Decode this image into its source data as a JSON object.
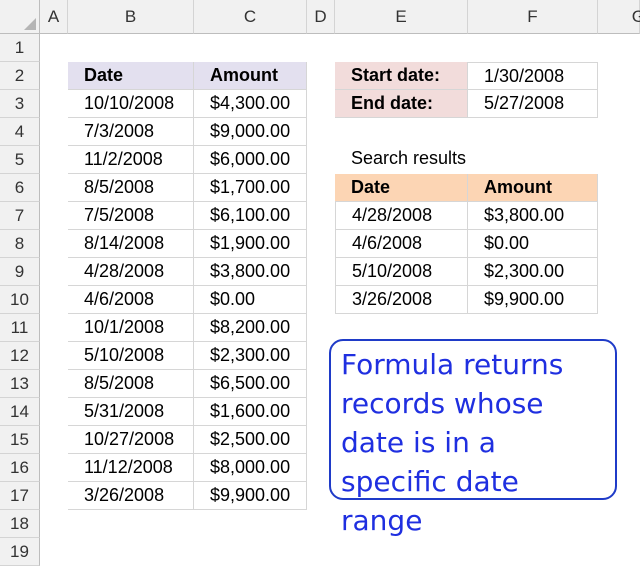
{
  "columns": [
    "A",
    "B",
    "C",
    "D",
    "E",
    "F",
    "G"
  ],
  "rows": [
    "1",
    "2",
    "3",
    "4",
    "5",
    "6",
    "7",
    "8",
    "9",
    "10",
    "11",
    "12",
    "13",
    "14",
    "15",
    "16",
    "17",
    "18",
    "19"
  ],
  "main_table": {
    "headers": {
      "date": "Date",
      "amount": "Amount"
    },
    "rows": [
      {
        "date": "10/10/2008",
        "amount": "$4,300.00"
      },
      {
        "date": "7/3/2008",
        "amount": "$9,000.00"
      },
      {
        "date": "11/2/2008",
        "amount": "$6,000.00"
      },
      {
        "date": "8/5/2008",
        "amount": "$1,700.00"
      },
      {
        "date": "7/5/2008",
        "amount": "$6,100.00"
      },
      {
        "date": "8/14/2008",
        "amount": "$1,900.00"
      },
      {
        "date": "4/28/2008",
        "amount": "$3,800.00"
      },
      {
        "date": "4/6/2008",
        "amount": "$0.00"
      },
      {
        "date": "10/1/2008",
        "amount": "$8,200.00"
      },
      {
        "date": "5/10/2008",
        "amount": "$2,300.00"
      },
      {
        "date": "8/5/2008",
        "amount": "$6,500.00"
      },
      {
        "date": "5/31/2008",
        "amount": "$1,600.00"
      },
      {
        "date": "10/27/2008",
        "amount": "$2,500.00"
      },
      {
        "date": "11/12/2008",
        "amount": "$8,000.00"
      },
      {
        "date": "3/26/2008",
        "amount": "$9,900.00"
      }
    ]
  },
  "criteria": {
    "start_label": "Start date:",
    "start_value": "1/30/2008",
    "end_label": "End date:",
    "end_value": "5/27/2008"
  },
  "search_results": {
    "title": "Search results",
    "headers": {
      "date": "Date",
      "amount": "Amount"
    },
    "rows": [
      {
        "date": "4/28/2008",
        "amount": "$3,800.00"
      },
      {
        "date": "4/6/2008",
        "amount": "$0.00"
      },
      {
        "date": "5/10/2008",
        "amount": "$2,300.00"
      },
      {
        "date": "3/26/2008",
        "amount": "$9,900.00"
      }
    ]
  },
  "callout": {
    "text": "Formula returns records whose date is in a specific date range"
  },
  "colors": {
    "main_header": "#e3e0ef",
    "criteria_label": "#f2dcdb",
    "results_header": "#fcd5b4",
    "callout_border": "#1f3bc8",
    "callout_text": "#1f2fe0"
  }
}
